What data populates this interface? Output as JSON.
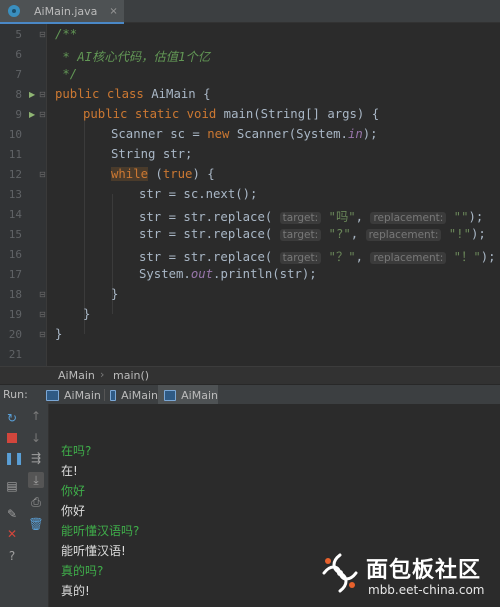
{
  "editor_tab": {
    "filename": "AiMain.java",
    "close": "×"
  },
  "breadcrumb": {
    "class": "AiMain",
    "method": "main()"
  },
  "code_lines": {
    "ln5": "5",
    "ln6": "6",
    "ln7": "7",
    "ln8": "8",
    "ln9": "9",
    "ln10": "10",
    "ln11": "11",
    "ln12": "12",
    "ln13": "13",
    "ln14": "14",
    "ln15": "15",
    "ln16": "16",
    "ln17": "17",
    "ln18": "18",
    "ln19": "19",
    "ln20": "20",
    "ln21": "21",
    "l5": "/**",
    "l6": " * AI核心代码，估值1个亿",
    "l7": " */",
    "l8_kw": "public class",
    "l8_rest": " AiMain {",
    "l9_kw": "public static void",
    "l9_rest": " main(String[] args) {",
    "l10_a": "Scanner sc = ",
    "l10_kw": "new",
    "l10_b": " Scanner(System.",
    "l10_fld": "in",
    "l10_c": ");",
    "l11": "String str;",
    "l12_kw": "while",
    "l12_a": " (",
    "l12_kw2": "true",
    "l12_b": ") {",
    "l13": "str = sc.next();",
    "l14_a": "str = str.replace(",
    "l14_h1": "target:",
    "l14_s1": "\"吗\"",
    "l14_h2": "replacement:",
    "l14_s2": "\"\"",
    "l14_c": ");",
    "l15_a": "str = str.replace(",
    "l15_h1": "target:",
    "l15_s1": "\"?\"",
    "l15_h2": "replacement:",
    "l15_s2": "\"!\"",
    "l15_c": ");",
    "l16_a": "str = str.replace(",
    "l16_h1": "target:",
    "l16_s1": "\"？\"",
    "l16_h2": "replacement:",
    "l16_s2": "\"！\"",
    "l16_c": ");",
    "l17_a": "System.",
    "l17_fld": "out",
    "l17_b": ".println(str);",
    "l18": "}",
    "l19": "}",
    "l20": "}"
  },
  "run_window": {
    "label": "Run:",
    "tabs": [
      "AiMain",
      "AiMain",
      "AiMain"
    ],
    "active_tab": 2
  },
  "console_output": [
    {
      "kind": "input",
      "text": "在吗?"
    },
    {
      "kind": "output",
      "text": "在!"
    },
    {
      "kind": "input",
      "text": "你好"
    },
    {
      "kind": "output",
      "text": "你好"
    },
    {
      "kind": "input",
      "text": "能听懂汉语吗?"
    },
    {
      "kind": "output",
      "text": "能听懂汉语!"
    },
    {
      "kind": "input",
      "text": "真的吗?"
    },
    {
      "kind": "output",
      "text": "真的!"
    }
  ],
  "watermark": {
    "title": "面包板社区",
    "url": "mbb.eet-china.com"
  },
  "colors": {
    "background": "#2b2b2b",
    "keyword": "#cc7832",
    "comment": "#629755",
    "string": "#6a8759",
    "field": "#9876aa",
    "console_input": "#3fae4a"
  }
}
